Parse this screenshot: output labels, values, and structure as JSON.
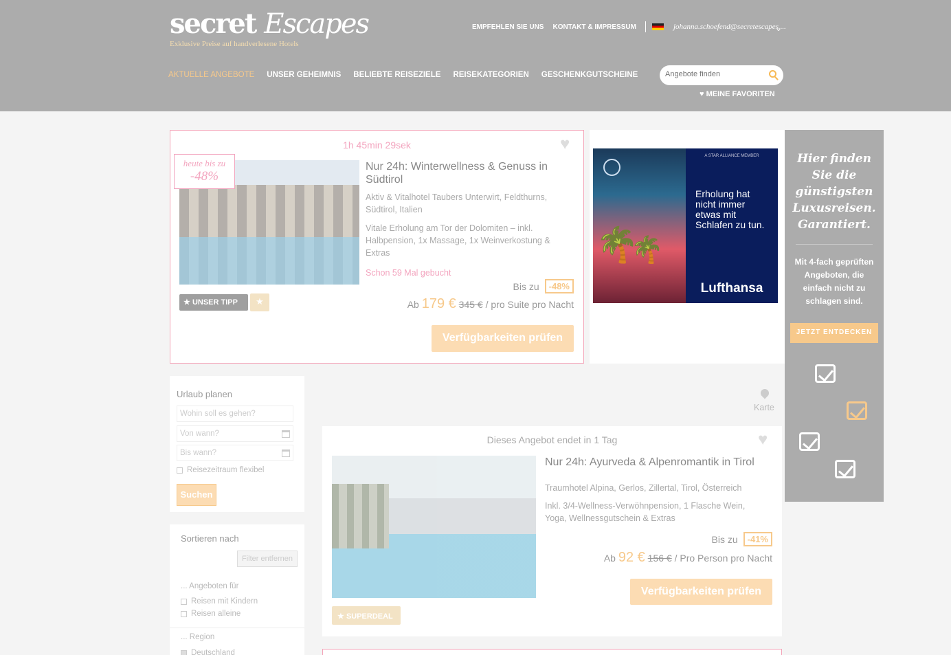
{
  "header": {
    "logo_main": "secret",
    "logo_escapes": "Escapes",
    "logo_tagline": "Exklusive Preise auf handverlesene Hotels",
    "top_links": [
      "EMPFEHLEN SIE UNS",
      "KONTAKT & IMPRESSUM"
    ],
    "user_email": "johanna.schoefend@secretescapes....",
    "nav": [
      "AKTUELLE ANGEBOTE",
      "UNSER GEHEIMNIS",
      "BELIEBTE REISEZIELE",
      "REISEKATEGORIEN",
      "GESCHENKGUTSCHEINE"
    ],
    "search_placeholder": "Angebote finden",
    "favorites": "MEINE FAVORITEN"
  },
  "deal1": {
    "timer": "1h 45min 29sek",
    "badge_line1": "heute bis zu",
    "badge_line2": "-48%",
    "title": "Nur 24h: Winterwellness & Genuss in Südtirol",
    "location": "Aktiv & Vitalhotel Taubers Unterwirt, Feldthurns, Südtirol, Italien",
    "description": "Vitale Erholung am Tor der Dolomiten – inkl. Halbpension, 1x Massage, 1x Weinverkostung & Extras",
    "booked": "Schon 59 Mal gebucht",
    "bis_zu": "Bis zu",
    "discount": "-48%",
    "ab": "Ab",
    "price": "179 €",
    "old_price": "345 €",
    "per": "/ pro Suite pro Nacht",
    "cta": "Verfügbarkeiten prüfen",
    "tip_label": "UNSER TIPP"
  },
  "ad": {
    "alliance": "A STAR ALLIANCE MEMBER",
    "text": "Erholung hat nicht immer etwas mit Schlafen zu tun.",
    "brand": "Lufthansa"
  },
  "promo": {
    "headline": "Hier finden Sie die günstigsten Luxusreisen. Garantiert.",
    "body": "Mit 4-fach geprüften Angeboten, die einfach nicht zu schlagen sind.",
    "button": "JETZT ENTDECKEN"
  },
  "plan": {
    "title": "Urlaub planen",
    "where_placeholder": "Wohin soll es gehen?",
    "from_placeholder": "Von wann?",
    "to_placeholder": "Bis wann?",
    "flexible": "Reisezeitraum flexibel",
    "search": "Suchen"
  },
  "sort": {
    "title": "Sortieren nach",
    "remove_filter": "Filter entfernen",
    "offers_for": "... Angeboten für",
    "opt_kids": "Reisen mit Kindern",
    "opt_alone": "Reisen alleine",
    "region": "... Region",
    "opt_germany": "Deutschland"
  },
  "map_label": "Karte",
  "deal2": {
    "ends": "Dieses Angebot endet in 1 Tag",
    "title": "Nur 24h: Ayurveda & Alpenromantik in Tirol",
    "location": "Traumhotel Alpina, Gerlos, Zillertal, Tirol, Österreich",
    "description": "Inkl. 3/4-Wellness-Verwöhnpension, 1 Flasche Wein, Yoga, Wellnessgutschein & Extras",
    "bis_zu": "Bis zu",
    "discount": "-41%",
    "ab": "Ab",
    "price": "92 €",
    "old_price": "156 €",
    "per": "/ Pro Person pro Nacht",
    "cta": "Verfügbarkeiten prüfen",
    "badge": "SUPERDEAL"
  }
}
